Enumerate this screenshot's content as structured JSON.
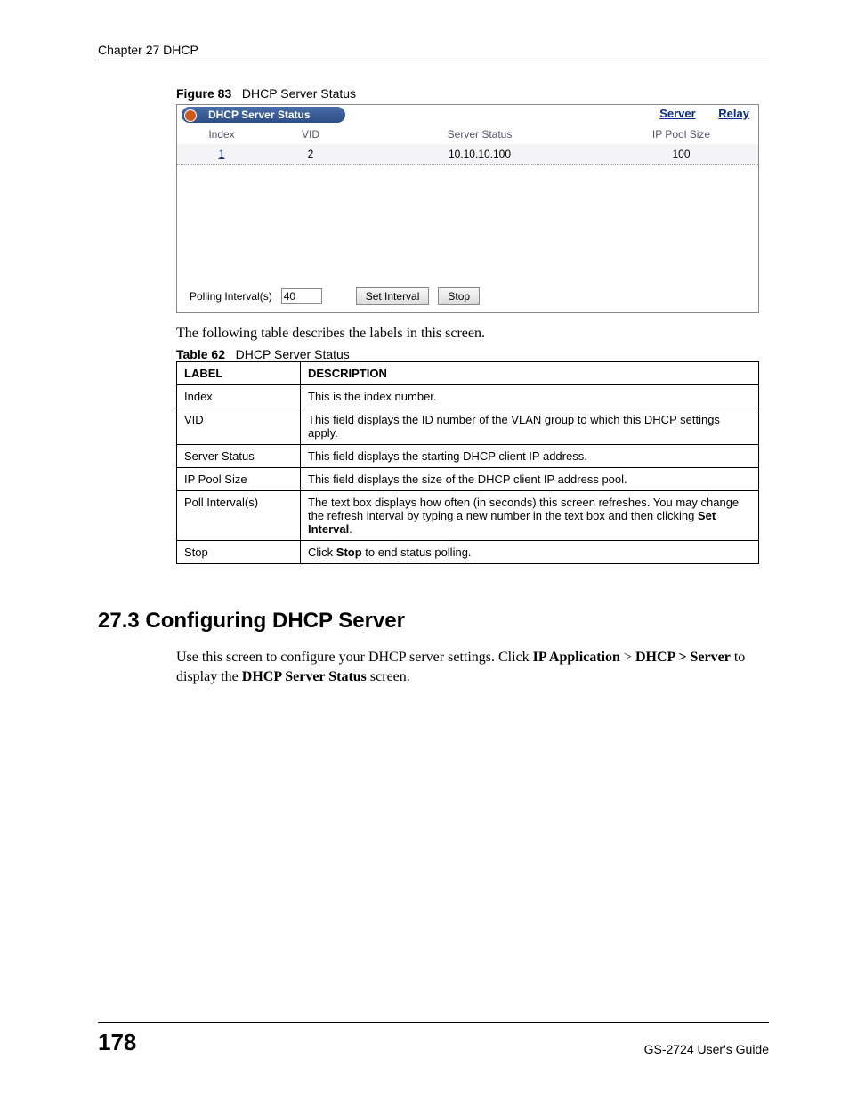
{
  "header": {
    "chapter": "Chapter 27 DHCP"
  },
  "figure": {
    "label": "Figure 83",
    "title": "DHCP Server Status",
    "panel_title": "DHCP Server Status",
    "tabs": {
      "server": "Server",
      "relay": "Relay"
    },
    "columns": {
      "index": "Index",
      "vid": "VID",
      "status": "Server Status",
      "pool": "IP Pool Size"
    },
    "row": {
      "index": "1",
      "vid": "2",
      "status": "10.10.10.100",
      "pool": "100"
    },
    "polling": {
      "label": "Polling Interval(s)",
      "value": "40",
      "set_label": "Set Interval",
      "stop_label": "Stop"
    }
  },
  "intro_line": "The following table describes the labels in this screen.",
  "table": {
    "label": "Table 62",
    "title": "DHCP Server Status",
    "head": {
      "label": "LABEL",
      "desc": "DESCRIPTION"
    },
    "rows": [
      {
        "label": "Index",
        "desc": "This is the index number."
      },
      {
        "label": "VID",
        "desc": "This field displays the ID number of the VLAN group to which this DHCP settings apply."
      },
      {
        "label": "Server Status",
        "desc": "This field displays the starting DHCP client IP address."
      },
      {
        "label": "IP Pool Size",
        "desc": "This field displays the size of the DHCP client IP address pool."
      },
      {
        "label": "Poll Interval(s)",
        "desc_pre": "The text box displays how often (in seconds) this screen refreshes. You may change the refresh interval by typing a new number in the text box and then clicking ",
        "desc_bold": "Set Interval",
        "desc_post": "."
      },
      {
        "label": "Stop",
        "desc_pre": "Click ",
        "desc_bold": "Stop",
        "desc_post": " to end status polling."
      }
    ]
  },
  "section": {
    "number_title": "27.3  Configuring DHCP Server",
    "p1_pre": "Use this screen to configure your DHCP server settings. Click ",
    "p1_b1": "IP Application",
    "p1_mid1": " > ",
    "p1_b2": "DHCP > Server",
    "p1_mid2": " to display the ",
    "p1_b3": "DHCP Server Status",
    "p1_post": " screen."
  },
  "footer": {
    "page": "178",
    "guide": "GS-2724 User's Guide"
  }
}
